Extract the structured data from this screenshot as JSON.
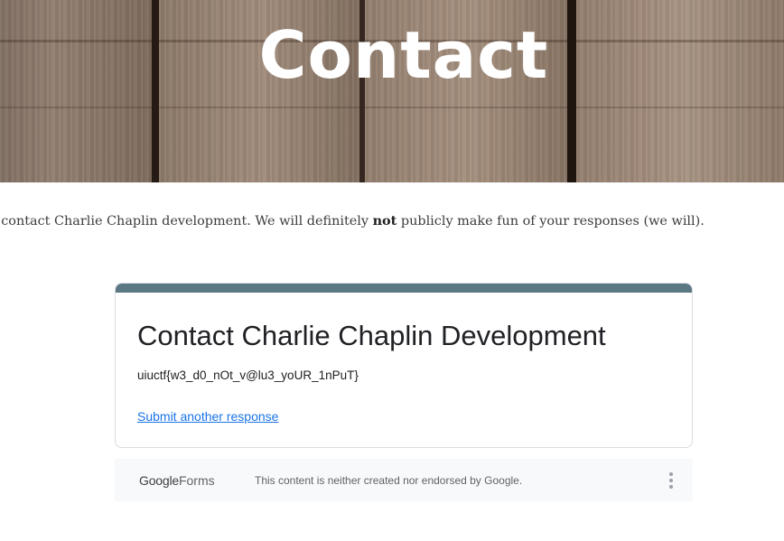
{
  "hero": {
    "title": "Contact"
  },
  "intro": {
    "before": "o contact Charlie Chaplin development. We will definitely ",
    "emphasis": "not",
    "after": " publicly make fun of your responses (we will)."
  },
  "form": {
    "accent_color": "#5b7784",
    "title": "Contact Charlie Chaplin Development",
    "confirmation_message": "uiuctf{w3_d0_nOt_v@lu3_yoUR_1nPuT}",
    "submit_another_link": "Submit another response"
  },
  "footer": {
    "logo_google": "Google",
    "logo_forms": "Forms",
    "disclaimer": "This content is neither created nor endorsed by Google.",
    "menu_icon": "more-vert-icon"
  }
}
